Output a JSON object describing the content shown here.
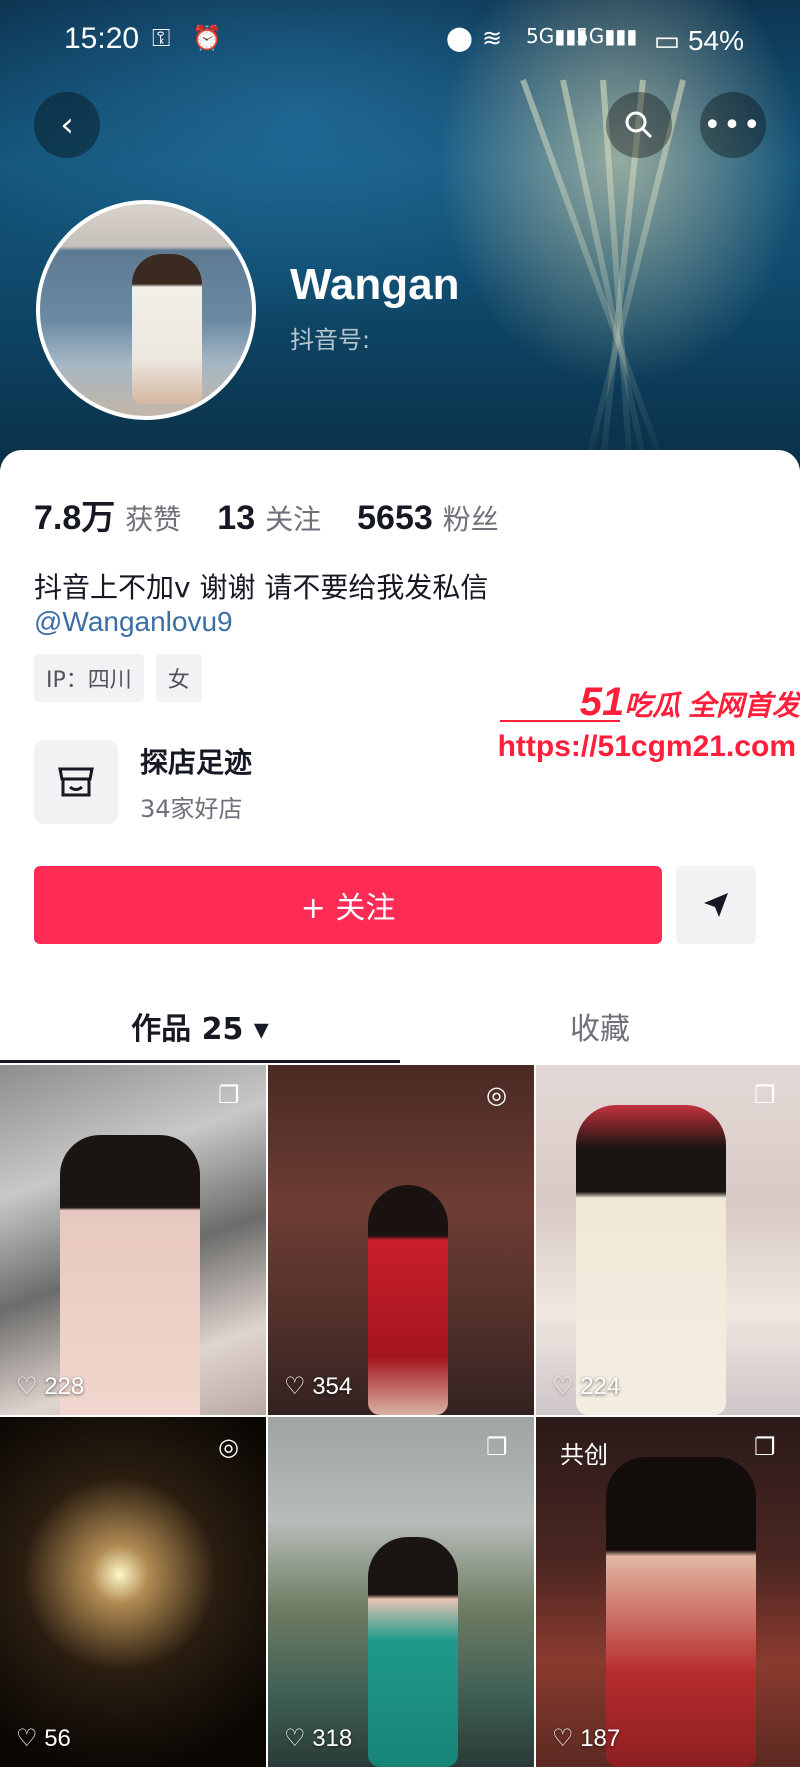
{
  "status_bar": {
    "time": "15:20",
    "battery": "54%"
  },
  "profile": {
    "username": "Wangan",
    "douyin_id_label": "抖音号:",
    "stats": [
      {
        "value": "7.8万",
        "label": "获赞"
      },
      {
        "value": "13",
        "label": "关注"
      },
      {
        "value": "5653",
        "label": "粉丝"
      }
    ],
    "bio": "抖音上不加v 谢谢 请不要给我发私信",
    "handle": "@Wanganlovu9",
    "tags": [
      "IP：四川",
      "女"
    ]
  },
  "shop": {
    "title": "探店足迹",
    "subtitle": "34家好店"
  },
  "actions": {
    "follow_label": "+ 关注"
  },
  "tabs": [
    {
      "label": "作品 25 ▾"
    },
    {
      "label": "收藏"
    }
  ],
  "videos": [
    {
      "likes": "228",
      "badge": "❐"
    },
    {
      "likes": "354",
      "badge": "◎"
    },
    {
      "likes": "224",
      "badge": "❐"
    },
    {
      "likes": "56",
      "badge": "◎"
    },
    {
      "likes": "318",
      "badge": "❐"
    },
    {
      "likes": "187",
      "badge": "❐",
      "tag": "共创"
    }
  ],
  "watermark": {
    "brand_num": "51",
    "brand_text": "吃瓜 全网首发",
    "url": "https://51cgm21.com"
  }
}
